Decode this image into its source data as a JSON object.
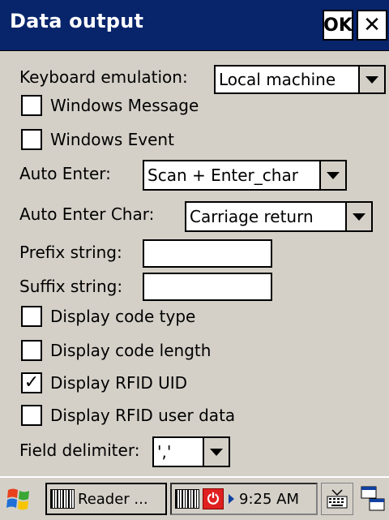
{
  "window": {
    "title": "Data output",
    "ok_label": "OK",
    "close_label": "✕"
  },
  "form": {
    "keyboard_emulation": {
      "label": "Keyboard emulation:",
      "value": "Local machine"
    },
    "windows_message": {
      "label": "Windows Message",
      "checked": false
    },
    "windows_event": {
      "label": "Windows Event",
      "checked": false
    },
    "auto_enter": {
      "label": "Auto Enter:",
      "value": "Scan + Enter_char"
    },
    "auto_enter_char": {
      "label": "Auto Enter Char:",
      "value": "Carriage return"
    },
    "prefix_string": {
      "label": "Prefix string:",
      "value": ""
    },
    "suffix_string": {
      "label": "Suffix string:",
      "value": ""
    },
    "display_code_type": {
      "label": "Display code type",
      "checked": false
    },
    "display_code_length": {
      "label": "Display code length",
      "checked": false
    },
    "display_rfid_uid": {
      "label": "Display RFID UID",
      "checked": true,
      "mark": "✓"
    },
    "display_rfid_user_data": {
      "label": "Display RFID user data",
      "checked": false
    },
    "field_delimiter": {
      "label": "Field delimiter:",
      "value": "','"
    }
  },
  "taskbar": {
    "task_label": "Reader ...",
    "time": "9:25 AM",
    "power_glyph": "⏻",
    "icons": [
      "windows-flag-icon",
      "barcode-icon",
      "power-icon",
      "keyboard-icon",
      "task-switch-icon"
    ]
  }
}
